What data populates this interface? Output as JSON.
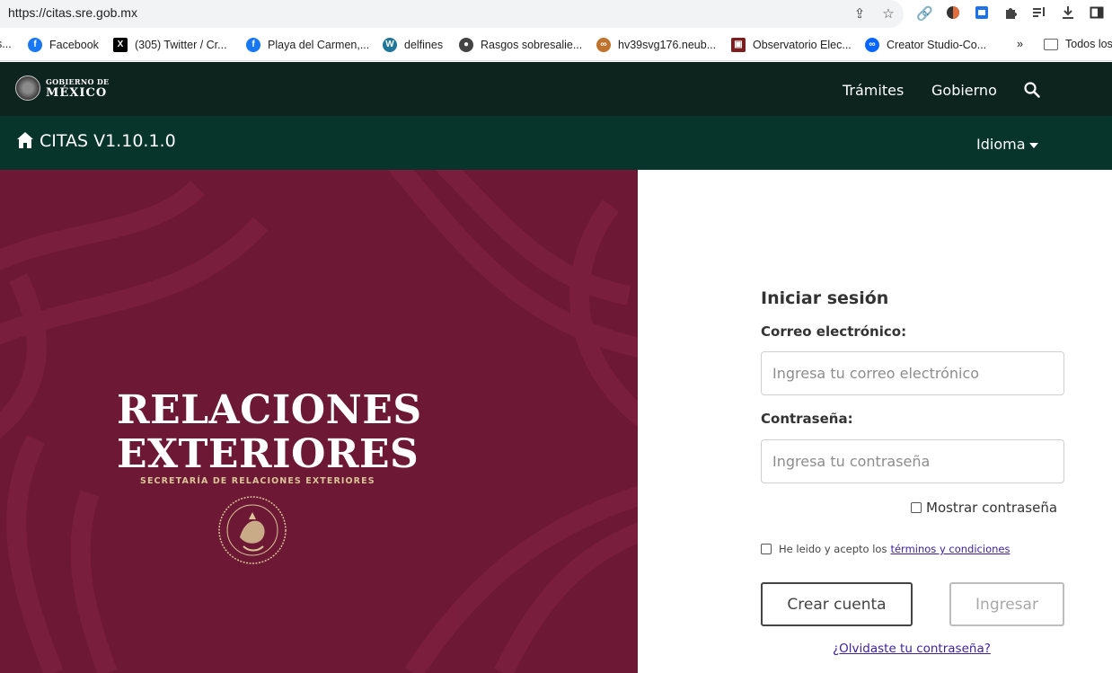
{
  "browser": {
    "url": "https://citas.sre.gob.mx",
    "bookmarks": [
      {
        "label": "s...",
        "color": "#888888"
      },
      {
        "label": "Facebook",
        "color": "#1877f2"
      },
      {
        "label": "(305) Twitter / Cr...",
        "color": "#000000"
      },
      {
        "label": "Playa del Carmen,...",
        "color": "#1877f2"
      },
      {
        "label": "delfines",
        "color": "#21759b"
      },
      {
        "label": "Rasgos sobresalie...",
        "color": "#444444"
      },
      {
        "label": "hv39svg176.neub...",
        "color": "#c0732c"
      },
      {
        "label": "Observatorio Elec...",
        "color": "#7a1f1f"
      },
      {
        "label": "Creator Studio-Co...",
        "color": "#0866ff"
      },
      {
        "label": "Todos los",
        "color": "#666666"
      }
    ],
    "more_bookmarks": "»"
  },
  "gov_header": {
    "logo_line1": "GOBIERNO DE",
    "logo_line2": "MÉXICO",
    "nav": [
      "Trámites",
      "Gobierno"
    ]
  },
  "app_header": {
    "title": "CITAS V1.10.1.0",
    "language_label": "Idioma"
  },
  "hero": {
    "title_line1": "RELACIONES",
    "title_line2": "EXTERIORES",
    "subtitle": "SECRETARÍA DE  RELACIONES EXTERIORES",
    "colors": {
      "background": "#6d1834",
      "accent": "#d9c597"
    }
  },
  "login": {
    "title": "Iniciar sesión",
    "email_label": "Correo electrónico:",
    "email_placeholder": "Ingresa tu correo electrónico",
    "password_label": "Contraseña:",
    "password_placeholder": "Ingresa tu contraseña",
    "show_password_label": "Mostrar contraseña",
    "terms_prefix": "He leido y acepto los ",
    "terms_link": "términos y condiciones",
    "create_account_label": "Crear cuenta",
    "login_label": "Ingresar",
    "forgot_password_label": "¿Olvidaste tu contraseña?"
  }
}
